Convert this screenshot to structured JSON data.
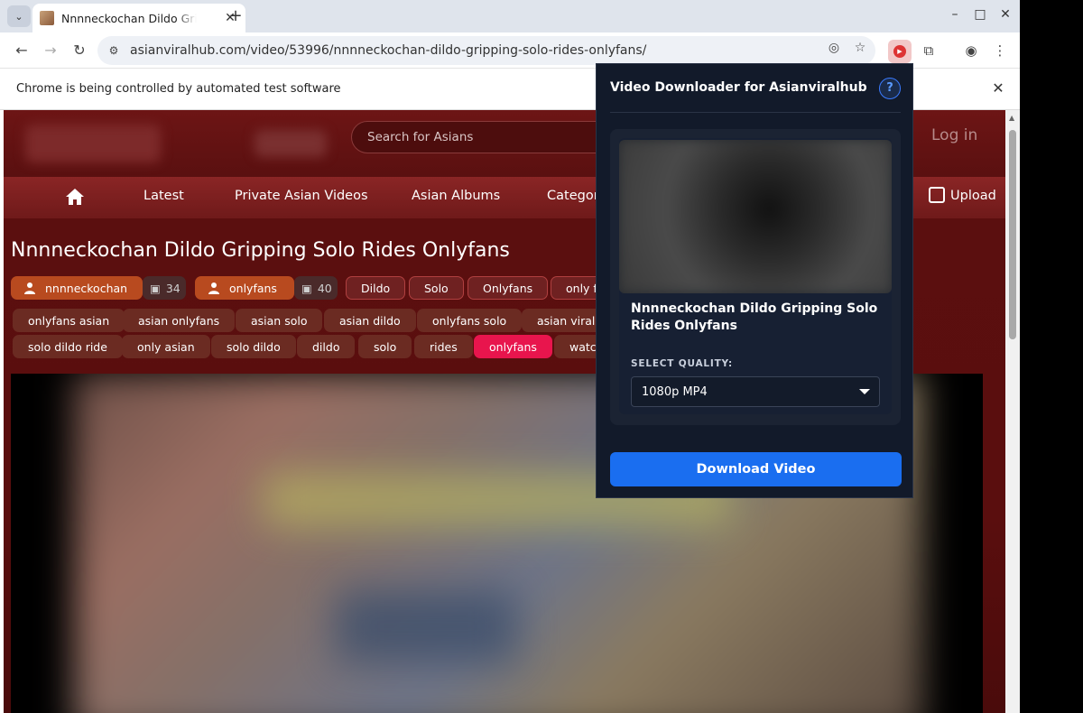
{
  "browser": {
    "tab_title": "Nnnneckochan Dildo Gripping Solo Rides Onlyfans",
    "tab_menu_icon": "chevron-down-icon",
    "new_tab_label": "+",
    "window_controls": [
      "–",
      "□",
      "✕"
    ],
    "url": "asianviralhub.com/video/53996/nnnneckochan-dildo-gripping-solo-rides-onlyfans/",
    "infobar_text": "Chrome is being controlled by automated test software"
  },
  "site": {
    "search_placeholder": "Search for Asians",
    "login_label": "Log in",
    "nav": {
      "latest": "Latest",
      "private_videos": "Private Asian Videos",
      "albums": "Asian Albums",
      "categories": "Categories",
      "upload": "Upload"
    },
    "video_title": "Nnnneckochan Dildo Gripping Solo Rides Onlyfans",
    "models": [
      {
        "name": "nnnneckochan",
        "count": "34"
      },
      {
        "name": "onlyfans",
        "count": "40"
      }
    ],
    "categories_row": [
      "Dildo",
      "Solo",
      "Onlyfans",
      "only fans"
    ],
    "tags_row1": [
      "onlyfans asian",
      "asian onlyfans",
      "asian solo",
      "asian dildo",
      "onlyfans solo",
      "asian viral"
    ],
    "tags_row2": [
      "solo dildo ride",
      "only asian",
      "solo dildo",
      "dildo",
      "solo",
      "rides",
      "onlyfans",
      "watch"
    ]
  },
  "popup": {
    "title": "Video Downloader for Asianviralhub",
    "help_label": "?",
    "video_title": "Nnnneckochan Dildo Gripping Solo Rides Onlyfans",
    "quality_label": "SELECT QUALITY:",
    "quality_value": "1080p MP4",
    "download_label": "Download Video"
  },
  "colors": {
    "page_bg": "#5a0e0e",
    "model_chip": "#b84a1f",
    "active_tag": "#e8154d",
    "popup_bg": "#121a2a",
    "download_btn": "#1a6ef0"
  }
}
